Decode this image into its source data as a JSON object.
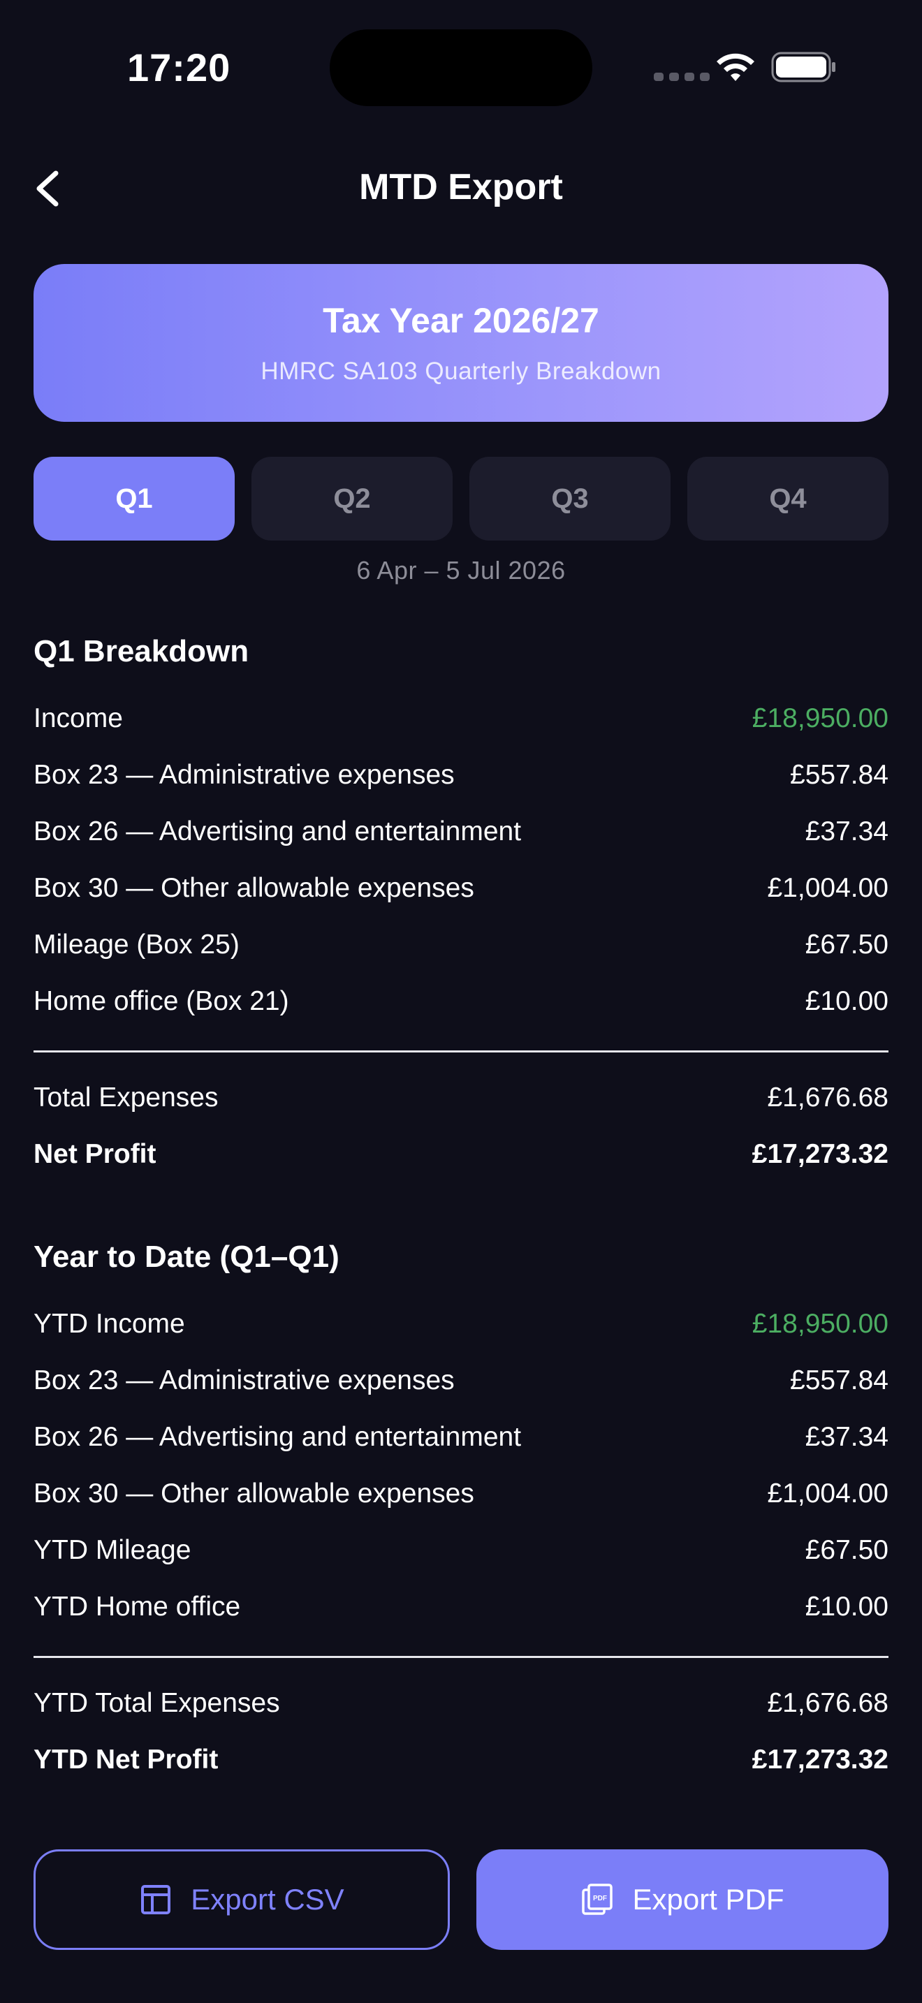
{
  "status_bar": {
    "time": "17:20"
  },
  "nav": {
    "title": "MTD Export",
    "back_icon": "chevron-left-icon"
  },
  "tax_card": {
    "title": "Tax Year 2026/27",
    "subtitle": "HMRC SA103 Quarterly Breakdown"
  },
  "quarters": {
    "tabs": [
      "Q1",
      "Q2",
      "Q3",
      "Q4"
    ],
    "selected": "Q1",
    "date_range": "6 Apr – 5 Jul 2026"
  },
  "breakdown": {
    "title": "Q1 Breakdown",
    "rows": [
      {
        "label": "Income",
        "value": "£18,950.00"
      },
      {
        "label": "Box 23 — Administrative expenses",
        "value": "£557.84"
      },
      {
        "label": "Box 26 — Advertising and entertainment",
        "value": "£37.34"
      },
      {
        "label": "Box 30 — Other allowable expenses",
        "value": "£1,004.00"
      },
      {
        "label": "Mileage (Box 25)",
        "value": "£67.50"
      },
      {
        "label": "Home office (Box 21)",
        "value": "£10.00"
      }
    ],
    "total_expenses": {
      "label": "Total Expenses",
      "value": "£1,676.68"
    },
    "net_profit": {
      "label": "Net Profit",
      "value": "£17,273.32"
    }
  },
  "ytd": {
    "title": "Year to Date (Q1–Q1)",
    "rows": [
      {
        "label": "YTD Income",
        "value": "£18,950.00"
      },
      {
        "label": "Box 23 — Administrative expenses",
        "value": "£557.84"
      },
      {
        "label": "Box 26 — Advertising and entertainment",
        "value": "£37.34"
      },
      {
        "label": "Box 30 — Other allowable expenses",
        "value": "£1,004.00"
      },
      {
        "label": "YTD Mileage",
        "value": "£67.50"
      },
      {
        "label": "YTD Home office",
        "value": "£10.00"
      }
    ],
    "total_expenses": {
      "label": "YTD Total Expenses",
      "value": "£1,676.68"
    },
    "net_profit": {
      "label": "YTD Net Profit",
      "value": "£17,273.32"
    }
  },
  "export": {
    "csv_label": "Export CSV",
    "csv_icon": "table-icon",
    "pdf_label": "Export PDF",
    "pdf_icon": "pdf-file-icon"
  },
  "colors": {
    "background": "#0e0e1a",
    "accent": "#7b7ef8",
    "income": "#4cae62",
    "tab_inactive": "#1c1c2c"
  }
}
